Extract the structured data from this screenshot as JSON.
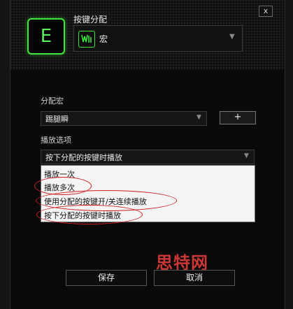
{
  "dialog": {
    "close_label": "x",
    "key_label": "E",
    "assign_title": "按键分配",
    "assign_value": "宏",
    "assign_icon": "macro-waveform-icon",
    "accent_color": "#3ee63e"
  },
  "macro": {
    "label": "分配宏",
    "value": "踢腿瞬",
    "add_label": "+"
  },
  "playback": {
    "label": "播放选项",
    "value": "按下分配的按键时播放",
    "options": [
      "播放一次",
      "播放多次",
      "使用分配的按键开/关连续播放",
      "按下分配的按键时播放"
    ]
  },
  "watermark": "思特网",
  "buttons": {
    "save": "保存",
    "cancel": "取消"
  }
}
